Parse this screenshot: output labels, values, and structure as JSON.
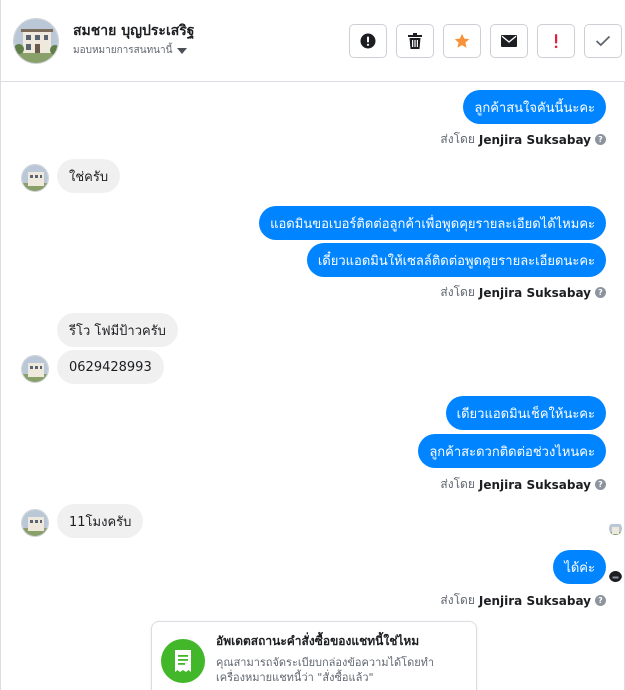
{
  "header": {
    "name": "สมชาย บุญประเสริฐ",
    "assign_label": "มอบหมายการสนทนานี้"
  },
  "toolbar": {
    "buttons": [
      "info-alert",
      "delete",
      "star",
      "mail",
      "spam",
      "done"
    ]
  },
  "colors": {
    "outgoing_bubble": "#0084ff",
    "incoming_bubble": "#f1f0f0",
    "star": "#f7923b",
    "spam": "#e41e3f",
    "card_icon": "#42b72a"
  },
  "messages": {
    "m1": "ลูกค้าสนใจคันนี้นะคะ",
    "m2": "ใช่ครับ",
    "m3": "แอดมินขอเบอร์ติดต่อลูกค้าเพื่อพูดคุยรายละเอียดได้ไหมคะ",
    "m4": "เดี๋ยวแอดมินให้เซลล์ติดต่อพูดคุยรายละเอียดนะคะ",
    "m5": "รีโว โฟมีป้าวครับ",
    "m6": "0629428993",
    "m7": "เดียวแอดมินเช็คให้นะคะ",
    "m8": "ลูกค้าสะดวกติดต่อช่วงไหนคะ",
    "m9": "11โมงครับ",
    "m10": "ได้ค่ะ"
  },
  "sent_by": {
    "prefix": "ส่งโดย",
    "agent": "Jenjira Suksabay"
  },
  "card": {
    "title": "อัพเดตสถานะคำสั่งซื้อของแชทนี้ใช่ไหม",
    "body": "คุณสามารถจัดระเบียบกล่องข้อความได้โดยทำเครื่องหมายแชทนี้ว่า \"สั่งซื้อแล้ว\""
  }
}
